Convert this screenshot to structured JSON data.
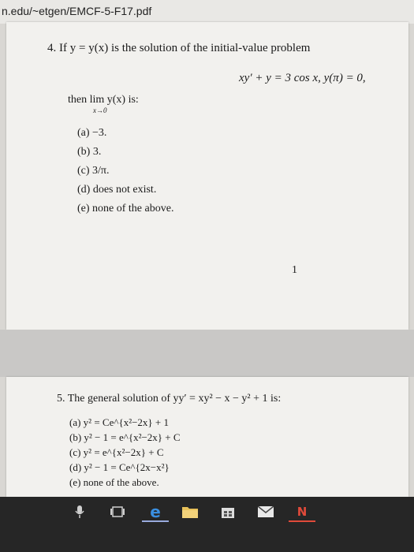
{
  "address_bar": {
    "url": "n.edu/~etgen/EMCF-5-F17.pdf"
  },
  "page1": {
    "question": "4. If y = y(x) is the solution of the initial-value problem",
    "equation": "xy′ + y = 3 cos x,   y(π) = 0,",
    "then_text": "then  lim y(x)  is:",
    "lim_subscript": "x→0",
    "options": [
      "(a) −3.",
      "(b) 3.",
      "(c) 3/π.",
      "(d) does not exist.",
      "(e) none of the above."
    ],
    "page_number": "1"
  },
  "page2": {
    "question": "5. The general solution of yy′ = xy² − x − y² + 1 is:",
    "options": [
      "(a) y² = Ce^{x²−2x} + 1",
      "(b) y² − 1 = e^{x²−2x} + C",
      "(c) y² = e^{x²−2x} + C",
      "(d) y² − 1 = Ce^{2x−x²}",
      "(e) none of the above."
    ]
  },
  "taskbar": {
    "icons": [
      "microphone-icon",
      "task-view-icon",
      "edge-browser-icon",
      "file-explorer-icon",
      "store-icon",
      "mail-icon",
      "news-icon"
    ],
    "edge_glyph": "e",
    "news_glyph": "N",
    "accent": "#9ad"
  }
}
